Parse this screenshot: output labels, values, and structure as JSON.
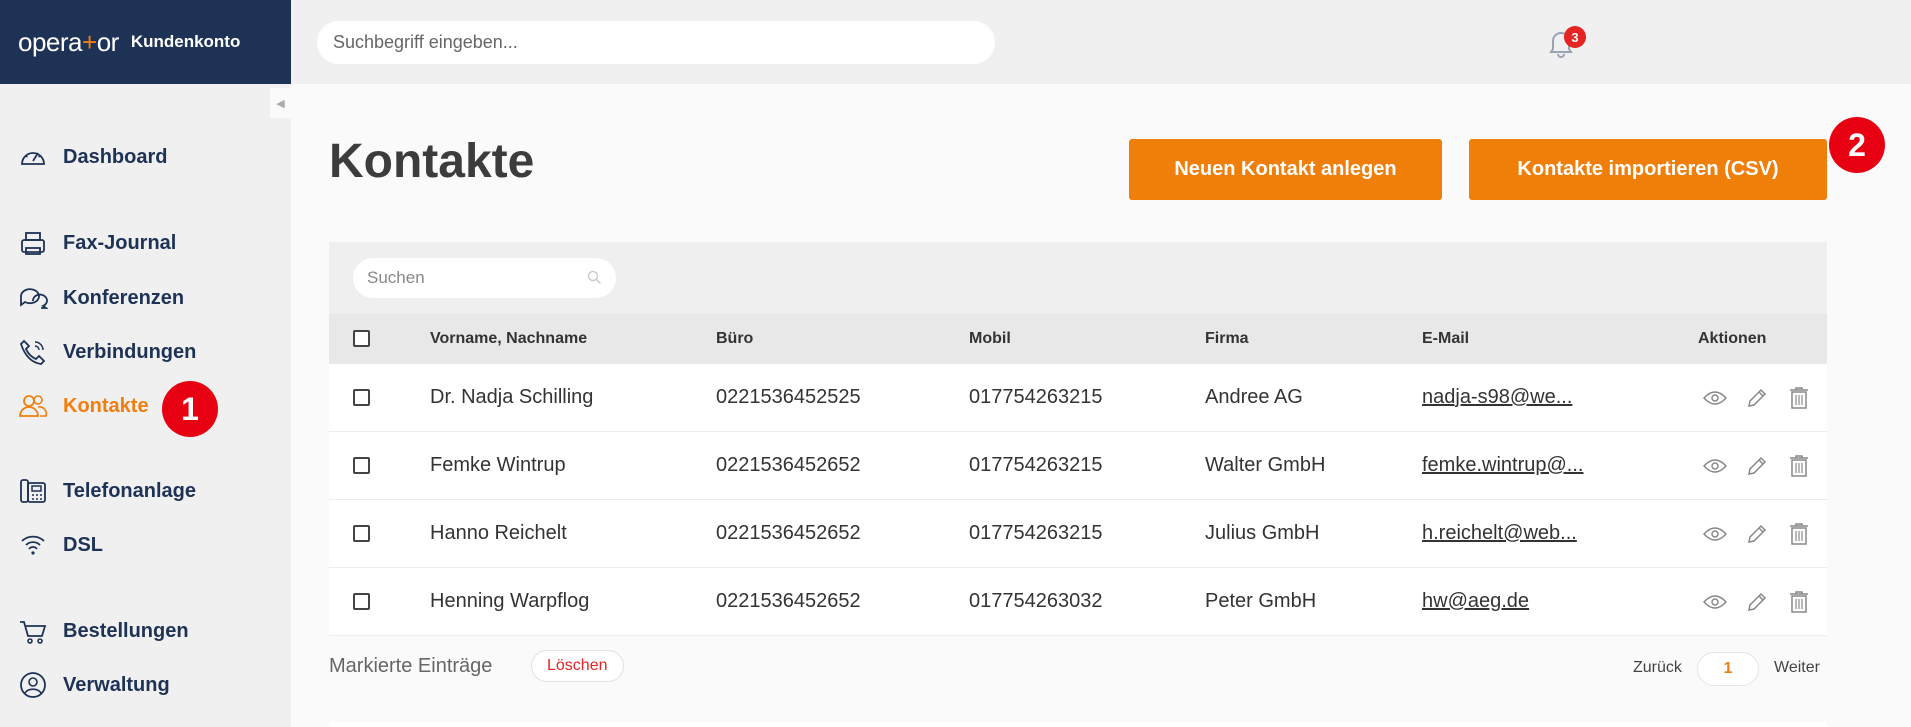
{
  "header": {
    "logo_main": "opera",
    "logo_plus": "+",
    "logo_end": "or",
    "logo_sub": "Kundenkonto",
    "search_placeholder": "Suchbegriff eingeben...",
    "notification_count": "3"
  },
  "sidebar": {
    "collapse_glyph": "◀",
    "items": [
      {
        "label": "Dashboard",
        "icon": "speedometer-icon"
      },
      {
        "label": "Fax-Journal",
        "icon": "fax-icon"
      },
      {
        "label": "Konferenzen",
        "icon": "chat-bubbles-icon"
      },
      {
        "label": "Verbindungen",
        "icon": "phone-call-icon"
      },
      {
        "label": "Kontakte",
        "icon": "users-icon",
        "active": true
      },
      {
        "label": "Telefonanlage",
        "icon": "desk-phone-icon"
      },
      {
        "label": "DSL",
        "icon": "wifi-icon"
      },
      {
        "label": "Bestellungen",
        "icon": "cart-icon"
      },
      {
        "label": "Verwaltung",
        "icon": "user-circle-icon"
      }
    ]
  },
  "callouts": [
    "1",
    "2"
  ],
  "main": {
    "title": "Kontakte",
    "btn_new": "Neuen Kontakt anlegen",
    "btn_import": "Kontakte importieren (CSV)",
    "table_search_placeholder": "Suchen",
    "columns": [
      "Vorname, Nachname",
      "Büro",
      "Mobil",
      "Firma",
      "E-Mail",
      "Aktionen"
    ],
    "rows": [
      {
        "name": "Dr. Nadja Schilling",
        "office": "0221536452525",
        "mobile": "017754263215",
        "company": "Andree AG",
        "email": "nadja-s98@we..."
      },
      {
        "name": "Femke Wintrup",
        "office": "0221536452652",
        "mobile": "017754263215",
        "company": "Walter GmbH",
        "email": "femke.wintrup@..."
      },
      {
        "name": "Hanno Reichelt",
        "office": "0221536452652",
        "mobile": "017754263215",
        "company": "Julius GmbH",
        "email": "h.reichelt@web..."
      },
      {
        "name": "Henning Warpflog",
        "office": "0221536452652",
        "mobile": "017754263032",
        "company": "Peter GmbH",
        "email": "hw@aeg.de"
      }
    ],
    "marked_label": "Markierte Einträge",
    "delete_label": "Löschen",
    "pager_back": "Zurück",
    "pager_page": "1",
    "pager_next": "Weiter"
  },
  "colors": {
    "accent": "#f07f10",
    "navy": "#1e3256",
    "danger": "#e52424"
  }
}
